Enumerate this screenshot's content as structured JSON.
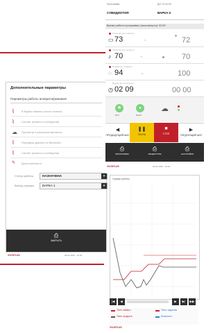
{
  "colors": {
    "accent_red": "#c0202a",
    "dark_bar": "#2e2e2e",
    "yellow": "#f2c400",
    "green_light": "#7fd47f",
    "orange": "#f08a2c"
  },
  "dialog": {
    "title": "Дополнительные параметры",
    "subtitle": "Параметры работы аппарата/режимов",
    "options": [
      {
        "icon": "signal-icon",
        "label": "В буфер памяти (после записи)"
      },
      {
        "icon": "signal-icon",
        "label": "Сигнал тревоги и сообщения"
      },
      {
        "icon": "cloud-icon",
        "label": "Просмотр в реальном времени"
      },
      {
        "icon": "signal-icon",
        "label": "Передача данных по Bluetooth"
      },
      {
        "icon": "signal-icon",
        "label": "Сигнал тревоги и сообщения"
      }
    ],
    "sub_option": "Дополнительно",
    "fields": [
      {
        "label": "Статус работы",
        "value": "НАЗНАЧЕНА"
      },
      {
        "label": "Выбор режима",
        "value": "ВАРКА-1"
      }
    ],
    "bottom_button": "ЗАКРЫТЬ",
    "footer_brand": "VIVOPLUS",
    "footer_info": "28.01.2015 · 12:45"
  },
  "phone": {
    "header": {
      "col1_label": "Программа",
      "col1_value": "СУВИДИОТИЯ",
      "col2_label": "ДО 12:44:18",
      "col2_value": "ВАРКА-2"
    },
    "status_text": "Время работы программы (часы:минуты): 02:09",
    "rows": [
      {
        "caption": "Температура в камере",
        "icon": "camera-icon",
        "value": "73",
        "tag": "°С",
        "target": "72"
      },
      {
        "caption": "Температура продукта",
        "icon": "probe-icon",
        "value": "70",
        "tag": "°С",
        "target": "70"
      },
      {
        "caption": "Влажность в камере",
        "icon": "humidity-icon",
        "value": "94",
        "tag": "%",
        "target": "100"
      },
      {
        "caption": "Время приготовления",
        "icon": "clock-icon",
        "value": "02 09",
        "tag": "",
        "target": "00 00"
      }
    ],
    "mini": [
      {
        "icon": "fan-icon",
        "label": "ВКЛ"
      },
      {
        "icon": "drop-icon",
        "label": "ВЫКЛ"
      }
    ],
    "function_buttons": [
      {
        "label": "ПРЕДЫДУЩИЙ ШАГ",
        "bg": "#ffffff"
      },
      {
        "label": "ПАУЗА",
        "bg": "#f2c400"
      },
      {
        "label": "СТОП",
        "bg": "#c0202a"
      },
      {
        "label": "СЛЕДУЮЩИЙ ШАГ",
        "bg": "#ffffff"
      }
    ],
    "nav": [
      {
        "label": "ПРОГРАММЫ"
      },
      {
        "label": "РЕЦЕПТУРЫ"
      },
      {
        "label": "НАСТРОЙКИ"
      }
    ],
    "footer_brand": "VIVOPLUS",
    "footer_info": "28.01.2015 · 12:44"
  },
  "graph": {
    "title": "График работы",
    "legend": [
      {
        "label": "Темп. камеры",
        "color": "#c0202a"
      },
      {
        "label": "Темп. продукта",
        "color": "#555555"
      },
      {
        "label": "Темп. заданная",
        "color": "#c0202a"
      },
      {
        "label": "Влажность",
        "color": "#2a7fd4"
      }
    ],
    "controls": [
      "|◀",
      "◀",
      "▶",
      "▶|",
      "▶▶"
    ]
  }
}
